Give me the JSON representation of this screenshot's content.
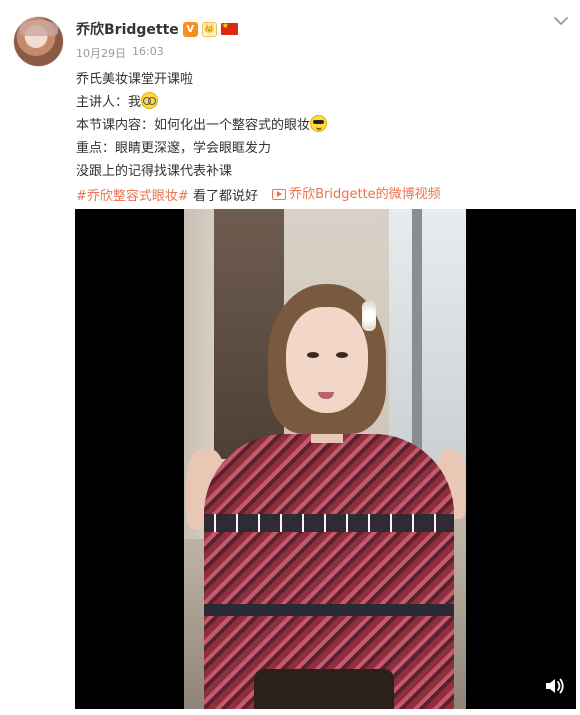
{
  "post": {
    "author": "乔欣Bridgette",
    "badges": {
      "verified": "V",
      "crown": "👑"
    },
    "date": "10月29日",
    "time": "16:03",
    "lines": [
      "乔氏美妆课堂开课啦",
      "主讲人：我",
      "本节课内容：如何化出一个整容式的眼妆",
      "重点：眼睛更深邃，学会眼眶发力",
      "没跟上的记得找课代表补课"
    ],
    "hashtag": "#乔欣整容式眼妆#",
    "hashtag_suffix": "看了都说好",
    "video_link": "乔欣Bridgette的微博视频"
  },
  "colors": {
    "accent": "#eb7350",
    "text": "#333333",
    "muted": "#999999",
    "verified_badge": "#f78e1e"
  },
  "icons": {
    "more": "chevron-down-icon",
    "mute": "speaker-icon",
    "video_link": "video-icon",
    "flag": "china-flag-icon"
  }
}
